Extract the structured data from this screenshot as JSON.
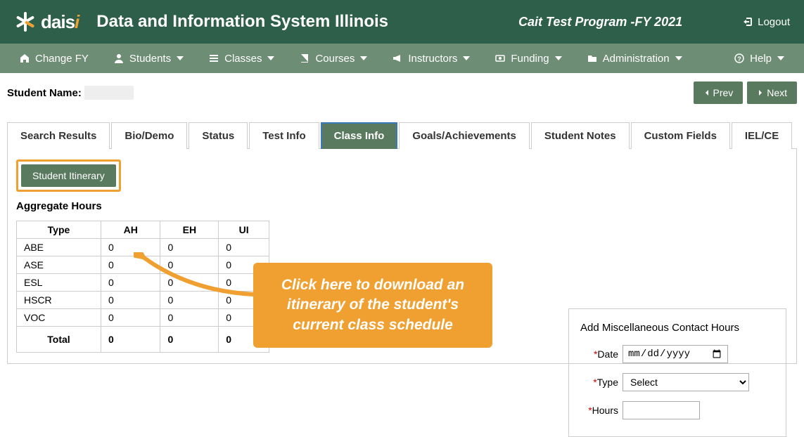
{
  "header": {
    "logo_text_a": "dais",
    "logo_text_b": "i",
    "app_title": "Data and Information System Illinois",
    "program_name": "Cait Test Program -FY 2021",
    "logout_label": "Logout"
  },
  "nav": {
    "change_fy": "Change FY",
    "students": "Students",
    "classes": "Classes",
    "courses": "Courses",
    "instructors": "Instructors",
    "funding": "Funding",
    "administration": "Administration",
    "help": "Help"
  },
  "topbar": {
    "student_name_label": "Student Name:",
    "student_name_value": "",
    "prev_label": "Prev",
    "next_label": "Next"
  },
  "tabs": {
    "search_results": "Search Results",
    "bio_demo": "Bio/Demo",
    "status": "Status",
    "test_info": "Test Info",
    "class_info": "Class Info",
    "goals": "Goals/Achievements",
    "student_notes": "Student Notes",
    "custom_fields": "Custom Fields",
    "iel_ce": "IEL/CE"
  },
  "class_info": {
    "itinerary_btn": "Student Itinerary",
    "aggregate_title": "Aggregate Hours",
    "columns": {
      "type": "Type",
      "ah": "AH",
      "eh": "EH",
      "ui": "UI"
    },
    "rows": [
      {
        "type": "ABE",
        "ah": "0",
        "eh": "0",
        "ui": "0"
      },
      {
        "type": "ASE",
        "ah": "0",
        "eh": "0",
        "ui": "0"
      },
      {
        "type": "ESL",
        "ah": "0",
        "eh": "0",
        "ui": "0"
      },
      {
        "type": "HSCR",
        "ah": "0",
        "eh": "0",
        "ui": "0"
      },
      {
        "type": "VOC",
        "ah": "0",
        "eh": "0",
        "ui": "0"
      }
    ],
    "total": {
      "label": "Total",
      "ah": "0",
      "eh": "0",
      "ui": "0"
    }
  },
  "misc": {
    "title": "Add Miscellaneous Contact Hours",
    "date_label": "Date",
    "date_placeholder": "mm/dd/yyyy",
    "type_label": "Type",
    "type_selected": "Select",
    "hours_label": "Hours"
  },
  "callout": {
    "text": "Click here to download an itinerary of the student's current class schedule"
  }
}
